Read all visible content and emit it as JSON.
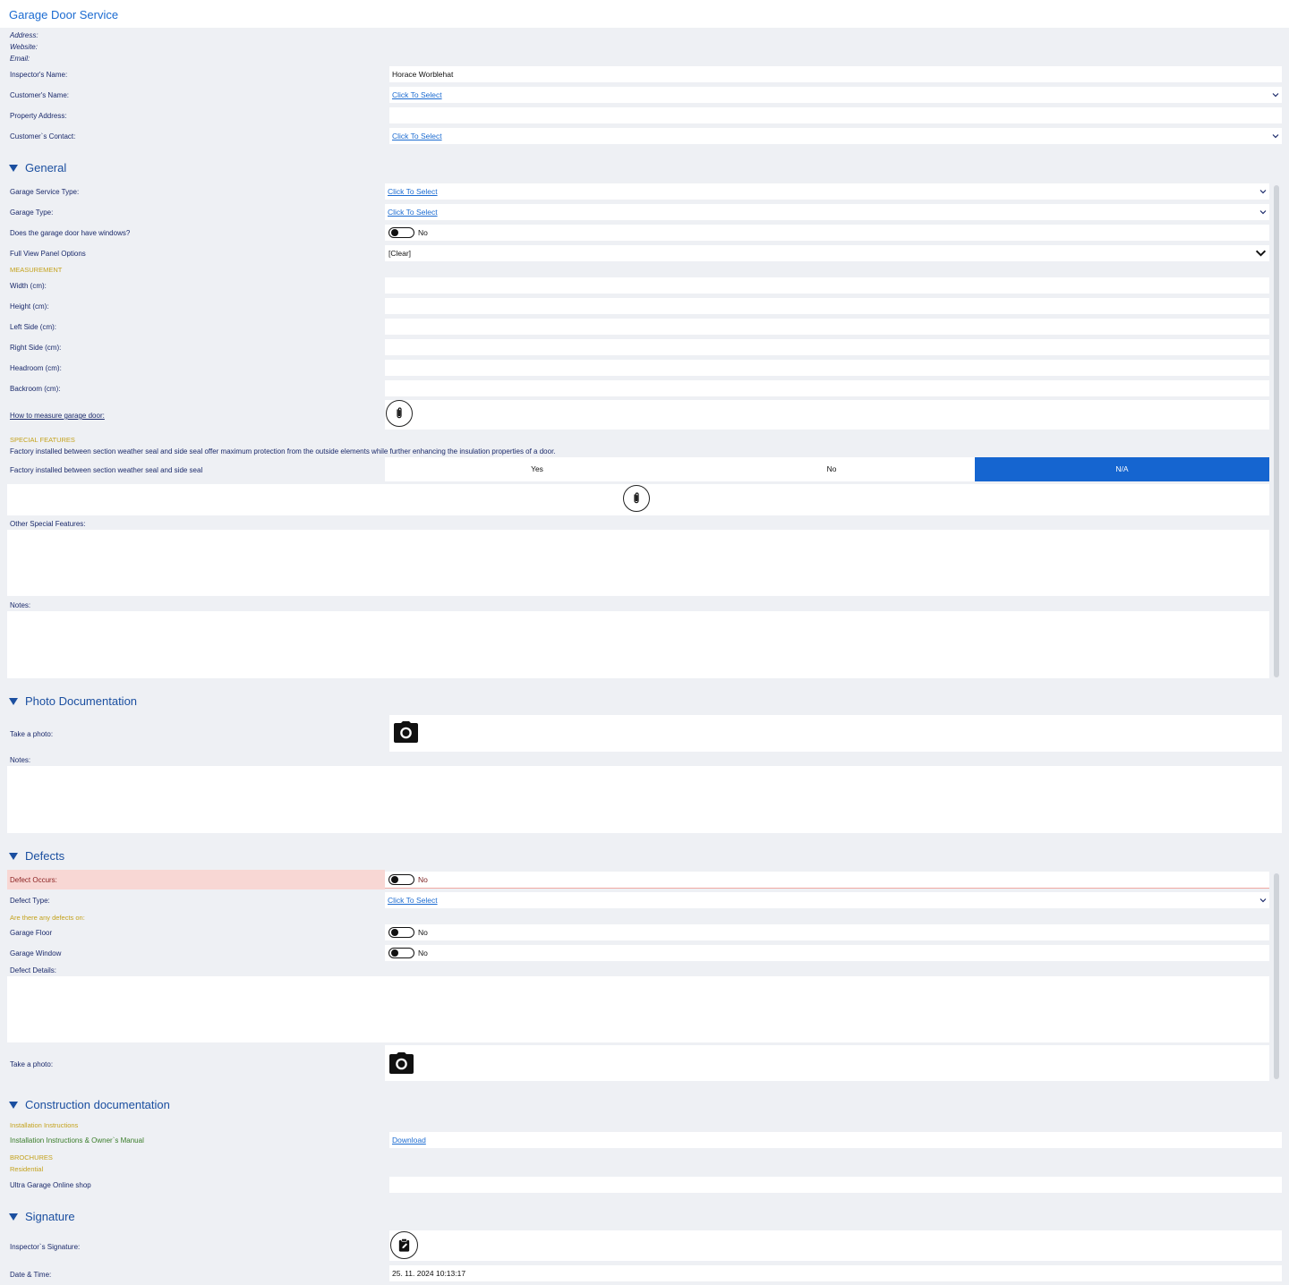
{
  "header": {
    "title": "Garage Door Service",
    "address_label": "Address:",
    "website_label": "Website:",
    "email_label": "Email:"
  },
  "info": {
    "inspector_label": "Inspector's Name:",
    "inspector_value": "Horace Worblehat",
    "customer_name_label": "Customer's Name:",
    "customer_name_value": "Click To Select",
    "property_address_label": "Property Address:",
    "customer_contact_label": "Customer`s Contact:",
    "customer_contact_value": "Click To Select"
  },
  "general": {
    "heading": "General",
    "service_type_label": "Garage Service Type:",
    "service_type_value": "Click To Select",
    "garage_type_label": "Garage Type:",
    "garage_type_value": "Click To Select",
    "windows_label": "Does the garage door have windows?",
    "windows_value": "No",
    "panel_label": "Full View Panel Options",
    "panel_value": "[Clear]",
    "measurement_heading": "MEASUREMENT",
    "width_label": "Width (cm):",
    "height_label": "Height (cm):",
    "left_label": "Left Side (cm):",
    "right_label": "Right Side (cm):",
    "headroom_label": "Headroom (cm):",
    "backroom_label": "Backroom (cm):",
    "how_to_label": "How to measure garage door:",
    "special_heading": "SPECIAL FEATURES",
    "special_desc": "Factory installed between section weather seal and side seal offer maximum protection from the outside elements while further enhancing the insulation properties of a door.",
    "seal_label": "Factory installed between section weather seal and side seal",
    "seal_options": [
      "Yes",
      "No",
      "N/A"
    ],
    "seal_selected": "N/A",
    "other_label": "Other Special Features:",
    "notes_label": "Notes:"
  },
  "photo": {
    "heading": "Photo Documentation",
    "take_photo_label": "Take a photo:",
    "notes_label": "Notes:"
  },
  "defects": {
    "heading": "Defects",
    "occurs_label": "Defect Occurs:",
    "occurs_value": "No",
    "type_label": "Defect Type:",
    "type_value": "Click To Select",
    "any_label": "Are there any defects on:",
    "floor_label": "Garage Floor",
    "floor_value": "No",
    "window_label": "Garage Window",
    "window_value": "No",
    "details_label": "Defect Details:",
    "take_photo_label": "Take a photo:"
  },
  "construction": {
    "heading": "Construction documentation",
    "install_heading": "Installation Instructions",
    "manual_label": "Installation Instructions & Owner`s Manual",
    "manual_link": "Download",
    "brochures_heading": "BROCHURES",
    "residential_label": "Residential",
    "shop_label": "Ultra Garage Online shop"
  },
  "signature": {
    "heading": "Signature",
    "inspector_sig_label": "Inspector`s Signature:",
    "datetime_label": "Date & Time:",
    "datetime_value": "25. 11. 2024 10:13:17"
  },
  "colors": {
    "accent": "#1b6bd1",
    "selected_segment": "#1565d0",
    "gold": "#c4a21c",
    "defect_row_bg": "#f8d7d4"
  }
}
